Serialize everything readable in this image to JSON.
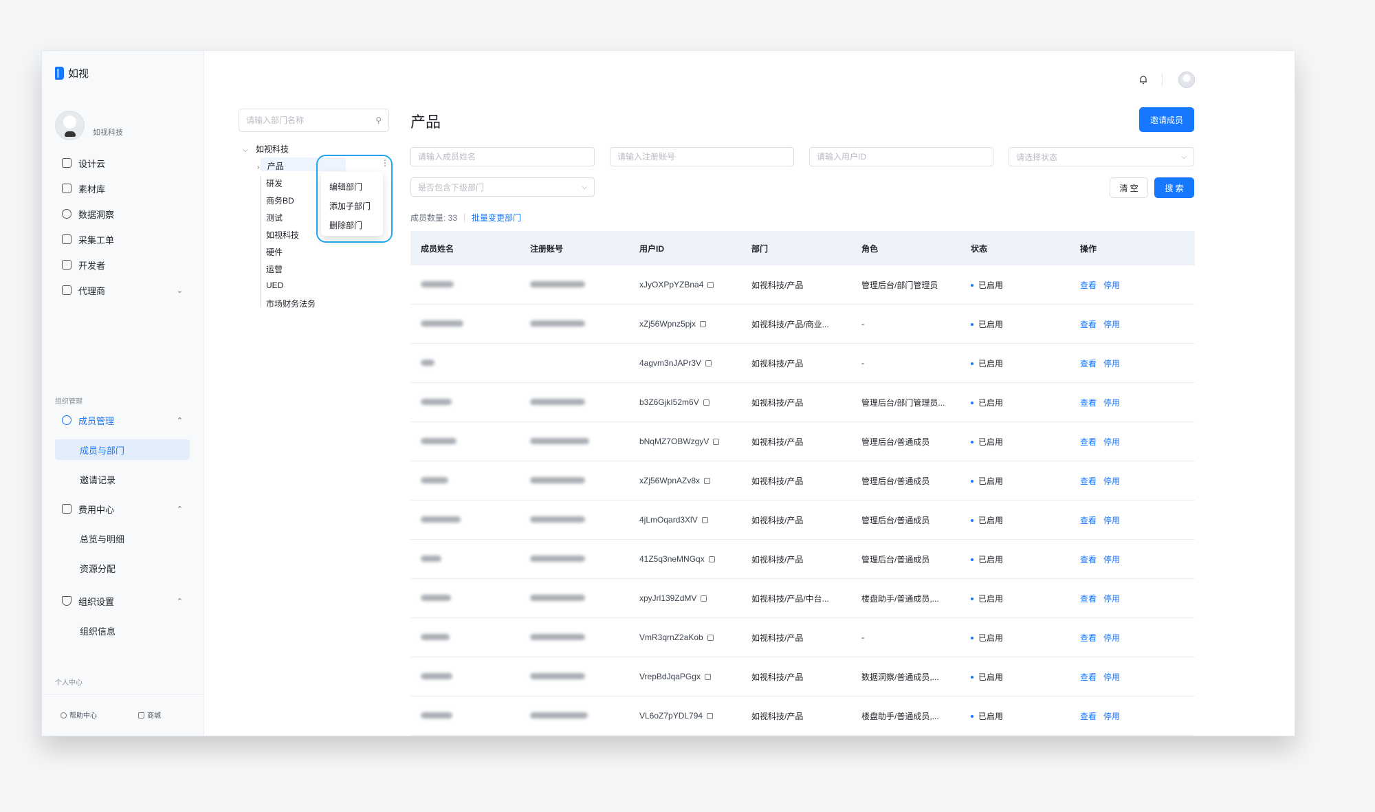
{
  "app": {
    "name": "如视"
  },
  "profile": {
    "name": "如视科技"
  },
  "nav": {
    "items": [
      {
        "label": "设计云",
        "icon": "design-cloud-icon"
      },
      {
        "label": "素材库",
        "icon": "folder-icon"
      },
      {
        "label": "数据洞察",
        "icon": "chart-icon"
      },
      {
        "label": "采集工单",
        "icon": "document-icon"
      },
      {
        "label": "开发者",
        "icon": "developer-icon"
      },
      {
        "label": "代理商",
        "icon": "briefcase-icon"
      }
    ],
    "org_section": "组织管理",
    "member_mgmt": "成员管理",
    "member_sub": [
      "成员与部门",
      "邀请记录"
    ],
    "fee_center": "费用中心",
    "fee_sub": [
      "总览与明细",
      "资源分配"
    ],
    "org_settings": "组织设置",
    "org_sub": [
      "组织信息"
    ],
    "personal_section": "个人中心",
    "help": "帮助中心",
    "store": "商城"
  },
  "tree": {
    "search_placeholder": "请输入部门名称",
    "root": "如视科技",
    "selected": "产品",
    "children": [
      "研发",
      "商务BD",
      "测试",
      "如视科技",
      "硬件",
      "运营",
      "UED",
      "市场财务法务"
    ],
    "context_menu": [
      "编辑部门",
      "添加子部门",
      "删除部门"
    ]
  },
  "main": {
    "title": "产品",
    "invite_button": "邀请成员",
    "filters": {
      "name_placeholder": "请输入成员姓名",
      "account_placeholder": "请输入注册账号",
      "userid_placeholder": "请输入用户ID",
      "status_placeholder": "请选择状态",
      "include_sub_placeholder": "是否包含下级部门"
    },
    "clear_button": "清 空",
    "search_button": "搜 索",
    "member_count": "成员数量: 33",
    "batch_change": "批量变更部门"
  },
  "table": {
    "headers": [
      "成员姓名",
      "注册账号",
      "用户ID",
      "部门",
      "角色",
      "状态",
      "操作"
    ],
    "rows": [
      {
        "user_id": "xJyOXPpYZBna4",
        "dept": "如视科技/产品",
        "role": "管理后台/部门管理员",
        "status": "已启用"
      },
      {
        "user_id": "xZj56Wpnz5pjx",
        "dept": "如视科技/产品/商业...",
        "role": "-",
        "status": "已启用"
      },
      {
        "user_id": "4agvm3nJAPr3V",
        "dept": "如视科技/产品",
        "role": "-",
        "status": "已启用"
      },
      {
        "user_id": "b3Z6GjkI52m6V",
        "dept": "如视科技/产品",
        "role": "管理后台/部门管理员...",
        "status": "已启用"
      },
      {
        "user_id": "bNqMZ7OBWzgyV",
        "dept": "如视科技/产品",
        "role": "管理后台/普通成员",
        "status": "已启用"
      },
      {
        "user_id": "xZj56WpnAZv8x",
        "dept": "如视科技/产品",
        "role": "管理后台/普通成员",
        "status": "已启用"
      },
      {
        "user_id": "4jLmOqard3XlV",
        "dept": "如视科技/产品",
        "role": "管理后台/普通成员",
        "status": "已启用"
      },
      {
        "user_id": "41Z5q3neMNGqx",
        "dept": "如视科技/产品",
        "role": "管理后台/普通成员",
        "status": "已启用"
      },
      {
        "user_id": "xpyJrl139ZdMV",
        "dept": "如视科技/产品/中台...",
        "role": "楼盘助手/普通成员,...",
        "status": "已启用"
      },
      {
        "user_id": "VmR3qrnZ2aKob",
        "dept": "如视科技/产品",
        "role": "-",
        "status": "已启用"
      },
      {
        "user_id": "VrepBdJqaPGgx",
        "dept": "如视科技/产品",
        "role": "数据洞察/普通成员,...",
        "status": "已启用"
      },
      {
        "user_id": "VL6oZ7pYDL794",
        "dept": "如视科技/产品",
        "role": "楼盘助手/普通成员,...",
        "status": "已启用"
      }
    ],
    "action_view": "查看",
    "action_disable": "停用"
  },
  "colors": {
    "accent": "#1677ff",
    "highlight_ring": "#23a6f2"
  }
}
